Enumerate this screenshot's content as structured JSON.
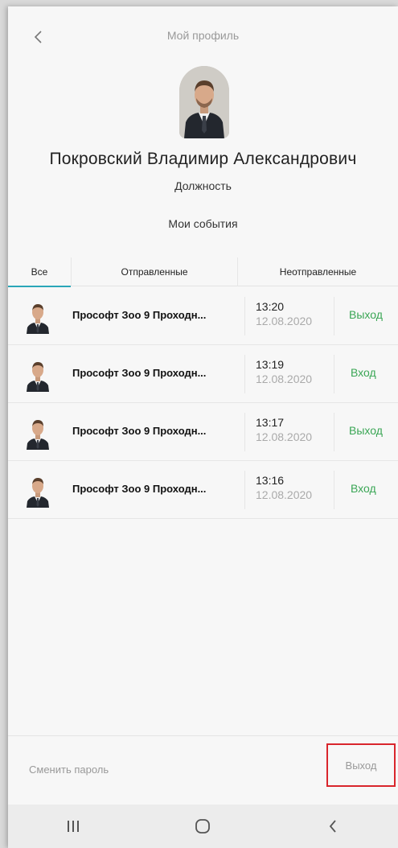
{
  "header": {
    "title": "Мой профиль",
    "back_icon": "chevron-left-icon"
  },
  "profile": {
    "full_name": "Покровский Владимир Александрович",
    "position": "Должность",
    "events_title": "Мои события"
  },
  "tabs": [
    {
      "label": "Все",
      "active": true
    },
    {
      "label": "Отправленные",
      "active": false
    },
    {
      "label": "Неотправленные",
      "active": false
    }
  ],
  "events": [
    {
      "name": "Прософт Зоо 9 Проходн...",
      "time": "13:20",
      "date": "12.08.2020",
      "direction": "Выход"
    },
    {
      "name": "Прософт Зоо 9 Проходн...",
      "time": "13:19",
      "date": "12.08.2020",
      "direction": "Вход"
    },
    {
      "name": "Прософт Зоо 9 Проходн...",
      "time": "13:17",
      "date": "12.08.2020",
      "direction": "Выход"
    },
    {
      "name": "Прософт Зоо 9 Проходн...",
      "time": "13:16",
      "date": "12.08.2020",
      "direction": "Вход"
    }
  ],
  "footer": {
    "change_password": "Сменить пароль",
    "logout": "Выход"
  },
  "colors": {
    "accent": "#2aa6b8",
    "direction_text": "#3aa655",
    "highlight_box": "#d9252c"
  },
  "navbar": {
    "icons": [
      "recent-apps-icon",
      "home-icon",
      "back-icon"
    ]
  }
}
